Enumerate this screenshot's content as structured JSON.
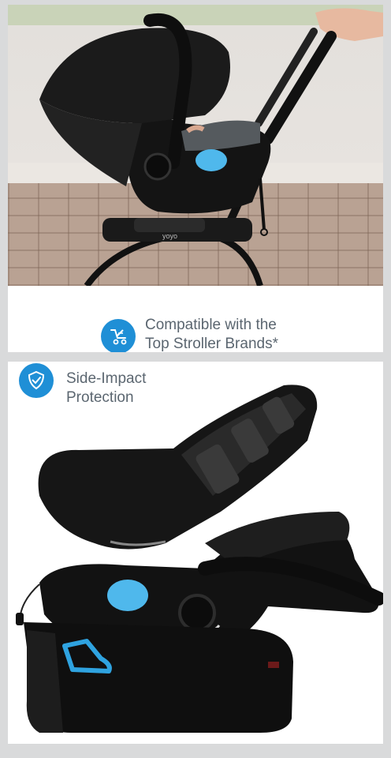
{
  "top_panel": {
    "feature_icon": "stroller-icon",
    "caption_line1": "Compatible with the",
    "caption_line2": "Top Stroller Brands*",
    "stroller_brand_mark": "yoyo"
  },
  "bottom_panel": {
    "feature_icon": "shield-check-icon",
    "caption_line1": "Side-Impact",
    "caption_line2": "Protection"
  },
  "colors": {
    "accent_blue": "#1f8fd6",
    "seat_blue": "#4fb8ec",
    "caption_text": "#5b6670",
    "background": "#d9dadb"
  }
}
